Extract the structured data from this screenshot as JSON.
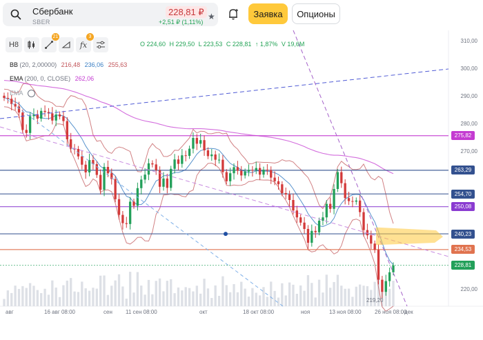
{
  "header": {
    "ticker_name": "Сбербанк",
    "ticker_code": "SBER",
    "price": "228,81 ₽",
    "price_change": "+2,51 ₽ (1,11%)",
    "order_button": "Заявка",
    "options_button": "Опционы"
  },
  "toolbar": {
    "timeframe": "H8",
    "drawing_badge": "21",
    "indicator_badge": "3"
  },
  "ohlc": {
    "o": "O 224,60",
    "h": "H 229,50",
    "l": "L 223,53",
    "c": "C 228,81",
    "change": "↑ 1,87%",
    "v": "V 19,6M"
  },
  "indicators": {
    "bb_name": "BB",
    "bb_params": "(20, 2,00000)",
    "bb_low": "216,48",
    "bb_mid": "236,06",
    "bb_high": "255,63",
    "ema_name": "EMA",
    "ema_params": "(200, 0, CLOSE)",
    "ema_value": "262,06",
    "ema2_name": "EMA"
  },
  "colors": {
    "bb_low": "#c2555a",
    "bb_mid": "#3a7fc4",
    "bb_high": "#c2555a",
    "ema": "#c43bd1",
    "up_candle": "#23a05a",
    "down_candle": "#d33a3a",
    "volume": "#dde0e6",
    "level_blue": "#33518f",
    "level_magenta": "#c43bd1",
    "level_orange": "#e0734f",
    "accent_yellow": "#ffc93b"
  },
  "y_axis": {
    "ticks": [
      "310,00",
      "300,00",
      "290,00",
      "280,00",
      "270,00",
      "220,00"
    ]
  },
  "levels": [
    {
      "label": "275,82",
      "value": 275.82,
      "color": "#c43bd1"
    },
    {
      "label": "263,29",
      "value": 263.29,
      "color": "#33518f"
    },
    {
      "label": "254,70",
      "value": 254.7,
      "color": "#33518f"
    },
    {
      "label": "250,08",
      "value": 250.08,
      "color": "#8a3bd1"
    },
    {
      "label": "240,23",
      "value": 240.23,
      "color": "#33518f"
    },
    {
      "label": "234,53",
      "value": 234.53,
      "color": "#e0734f"
    },
    {
      "label": "228,81",
      "value": 228.81,
      "color": "#23a05a"
    }
  ],
  "x_axis": {
    "ticks": [
      "авг",
      "16 авг 08:00",
      "сен",
      "11 сен 08:00",
      "окт",
      "18 окт 08:00",
      "ноя",
      "13 ноя 08:00",
      "26 ноя 08:00",
      "дек"
    ]
  },
  "low_marker": "219,20",
  "chart_data": {
    "type": "candlestick",
    "y_range": [
      214,
      314
    ],
    "closes": [
      289.5,
      289.2,
      287.3,
      286.4,
      284.2,
      277.9,
      276.8,
      282.9,
      283.4,
      282.0,
      284.8,
      284.4,
      283.9,
      281.3,
      283.5,
      282.8,
      281.1,
      274.5,
      271.1,
      271.0,
      268.3,
      265.3,
      262.5,
      267.0,
      265.5,
      261.6,
      256.2,
      264.5,
      262.2,
      260.1,
      252.8,
      247.1,
      244.1,
      243.8,
      251.9,
      250.4,
      256.8,
      259.9,
      261.7,
      265.8,
      265.4,
      263.3,
      257.3,
      260.3,
      256.9,
      263.8,
      267.2,
      265.6,
      268.7,
      268.5,
      271.1,
      275.0,
      272.9,
      274.2,
      270.5,
      268.4,
      269.0,
      267.1,
      267.1,
      262.6,
      259.3,
      262.2,
      264.4,
      263.1,
      261.4,
      262.8,
      263.4,
      263.3,
      264.1,
      261.7,
      263.5,
      263.3,
      260.6,
      259.3,
      258.2,
      255.0,
      254.5,
      252.5,
      248.7,
      246.2,
      244.3,
      242.0,
      237.0,
      241.3,
      240.8,
      245.0,
      246.2,
      251.1,
      249.3,
      256.5,
      262.6,
      258.6,
      253.2,
      252.1,
      251.9,
      252.3,
      248.1,
      241.6,
      239.7,
      236.7,
      234.4,
      223.6,
      219.2,
      223.1,
      226.3,
      228.8
    ]
  }
}
